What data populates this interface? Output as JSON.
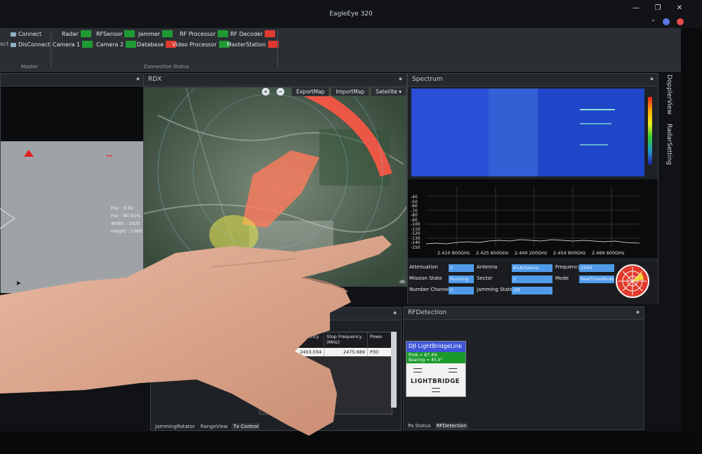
{
  "window": {
    "title": "EagleEye 320",
    "minimize": "—",
    "restore": "❐",
    "close": "✕"
  },
  "ribbon": {
    "master": {
      "connect_label": "Connect",
      "disconnect_label": "DisConnect",
      "group_label": "Master",
      "clipped_left_text": "ect"
    },
    "connection_status": {
      "group_label": "Connection Status",
      "items": [
        {
          "label": "Radar",
          "status": "green"
        },
        {
          "label": "Camera 1",
          "status": "green"
        },
        {
          "label": "RFSensor",
          "status": "green"
        },
        {
          "label": "Camera 2",
          "status": "green"
        },
        {
          "label": "Jammer",
          "status": "green"
        },
        {
          "label": "Database",
          "status": "red"
        },
        {
          "label": "RF Processor",
          "status": "green"
        },
        {
          "label": "Video Processor",
          "status": "green"
        },
        {
          "label": "RF Decoder",
          "status": "red"
        },
        {
          "label": "MasterStation",
          "status": "red"
        }
      ]
    }
  },
  "camera": {
    "fov": "Fov : 0.92",
    "foc": "Foc : 80.01%",
    "width": "Width : 1920",
    "height": "Height : 1080"
  },
  "rdx": {
    "title": "RDX",
    "export_map": "ExportMap",
    "import_map": "ImportMap",
    "map_type": "Satellite",
    "corner_label": "dB"
  },
  "spectrum": {
    "title": "Spectrum",
    "y_ticks": [
      "-40",
      "-50",
      "-60",
      "-70",
      "-80",
      "-90",
      "-100",
      "-110",
      "-120",
      "-130",
      "-140",
      "-150"
    ],
    "x_ticks": [
      "2.410 800GHz",
      "2.425 600GHz",
      "2.440 200GHz",
      "2.454 900GHz",
      "2.469 600GHz"
    ]
  },
  "params": {
    "attenuation_label": "Attenuation",
    "attenuation_value": "0",
    "antenna_label": "Antenna",
    "antenna_value": "A1Antenna",
    "frequency_label": "Frequency",
    "frequency_value": "2440",
    "mission_state_label": "Mission State",
    "mission_state_value": "Running",
    "sector_label": "Sector",
    "sector_value": "2",
    "mode_label": "Mode",
    "mode_value": "RealTimeMode",
    "number_channel_label": "Number Channel",
    "number_channel_value": "0",
    "jamming_state_label": "Jamming State",
    "jamming_state_value": "Off"
  },
  "side_tabs": {
    "doppler": "DopplerView",
    "radar_setting": "RadarSetting"
  },
  "tx_control": {
    "columns": [
      "Start Frequency (MHz)",
      "Stop Frequency (MHz)",
      "Powe"
    ],
    "row": {
      "start": "2403.034",
      "stop": "2475.689",
      "power": "P30"
    },
    "tabs": [
      "JammingRotator",
      "RangeView",
      "Tx Control"
    ]
  },
  "rf_detection": {
    "title": "RFDetection",
    "card_title": "DJI LightBridgeLink",
    "prob": "Prob = 87.4%",
    "bearing": "Bearing = 45.0°",
    "logo_text": "LIGHTBRIDGE",
    "tabs": [
      "Pa Status",
      "RFDetection"
    ]
  }
}
